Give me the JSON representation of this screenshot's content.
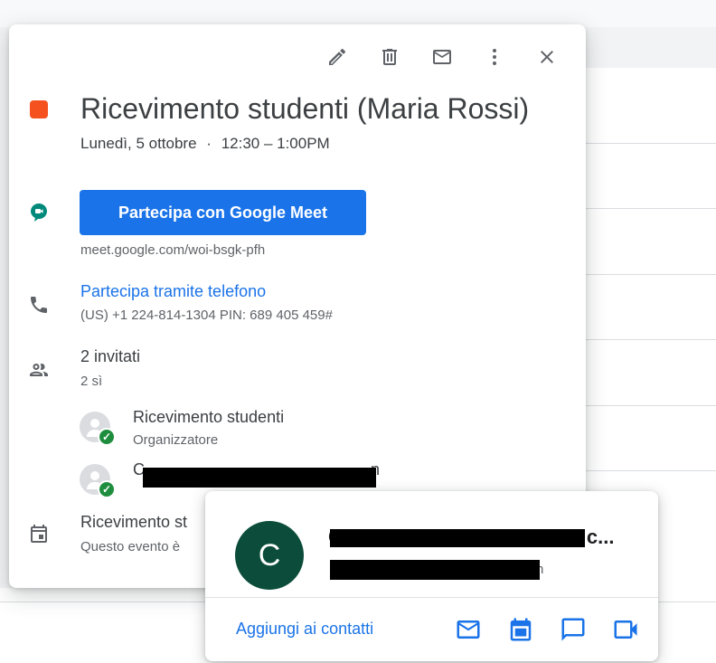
{
  "event": {
    "title": "Ricevimento studenti (Maria Rossi)",
    "date": "Lunedì, 5 ottobre",
    "separator": "·",
    "time": "12:30 – 1:00PM",
    "color": "#f4511e"
  },
  "toolbar": {
    "icons": [
      "pencil-icon",
      "trash-icon",
      "mail-icon",
      "more-vert-icon",
      "close-icon"
    ]
  },
  "meet": {
    "button_label": "Partecipa con Google Meet",
    "link": "meet.google.com/woi-bsgk-pfh"
  },
  "phone": {
    "label": "Partecipa tramite telefono",
    "detail": "(US) +1 224-814-1304 PIN: 689 405 459#"
  },
  "guests": {
    "title": "2 invitati",
    "summary": "2 sì",
    "list": [
      {
        "name": "Ricevimento studenti",
        "role": "Organizzatore"
      },
      {
        "name_visible_prefix": "C",
        "name_visible_suffix": "n"
      }
    ]
  },
  "calendar": {
    "name": "Ricevimento st",
    "note": "Questo evento è"
  },
  "hovercard": {
    "avatar_letter": "C",
    "name_visible_prefix": "C",
    "name_visible_suffix": "c...",
    "email_visible_suffix": "n",
    "add_contact_label": "Aggiungi ai contatti",
    "actions": [
      "mail-icon",
      "calendar-icon",
      "chat-icon",
      "video-icon"
    ],
    "accent": "#1a73e8",
    "avatar_color": "#0b4d3a"
  }
}
